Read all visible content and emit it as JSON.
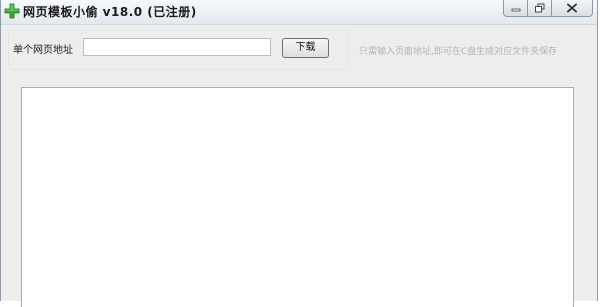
{
  "window": {
    "title": "网页模板小偷 v18.0 (已注册)",
    "icon": "green-plus-icon",
    "controls": [
      "minimize-icon",
      "restore-icon",
      "close-icon"
    ]
  },
  "form": {
    "url_label": "单个网页地址",
    "url_value": "",
    "download_label": "下载",
    "hint": "只需输入页面地址,即可在C盘生成对应文件夹保存"
  },
  "output": {
    "content": ""
  },
  "colors": {
    "titlebar": "#e3e8ee",
    "window_bg": "#ededed",
    "hint_text": "#b4b4b4",
    "app_icon": "#3aa935"
  }
}
